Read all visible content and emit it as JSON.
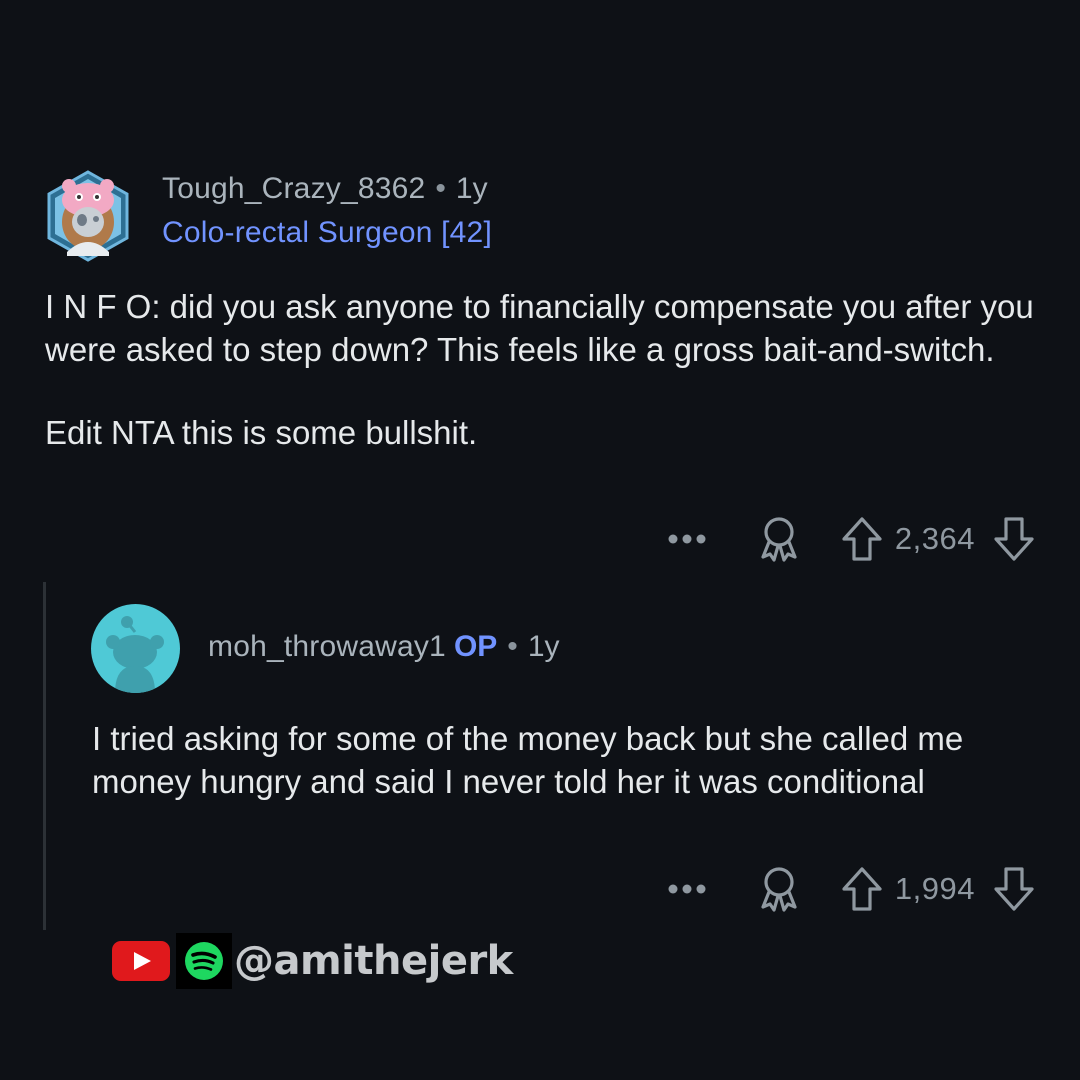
{
  "top_comment": {
    "username": "Tough_Crazy_8362",
    "separator": "•",
    "age": "1y",
    "flair": "Colo-rectal Surgeon [42]",
    "paragraphs": [
      "I N F O: did you ask anyone to financially compensate you after you were asked to step down? This feels like a gross bait-and-switch.",
      "Edit NTA this is some bullshit."
    ],
    "score": "2,364",
    "icons": [
      "more-options-icon",
      "award-icon",
      "upvote-icon",
      "downvote-icon"
    ]
  },
  "reply": {
    "username": "moh_throwaway1",
    "op_badge": "OP",
    "separator": "•",
    "age": "1y",
    "body": "I tried asking for some of the money back but she called me money hungry and said I never told her it was conditional",
    "score": "1,994",
    "icons": [
      "more-options-icon",
      "award-icon",
      "upvote-icon",
      "downvote-icon"
    ]
  },
  "watermark": {
    "handle": "@amithejerk",
    "icons": [
      "youtube-icon",
      "spotify-icon"
    ]
  },
  "colors": {
    "background": "#0e1116",
    "flair": "#7193ff",
    "op_badge": "#7193ff",
    "meta_text": "#aab4bc",
    "body_text": "#e6e9eb",
    "reply_avatar": "#4fc9d6",
    "youtube": "#e0191c",
    "spotify": "#1ed760"
  }
}
